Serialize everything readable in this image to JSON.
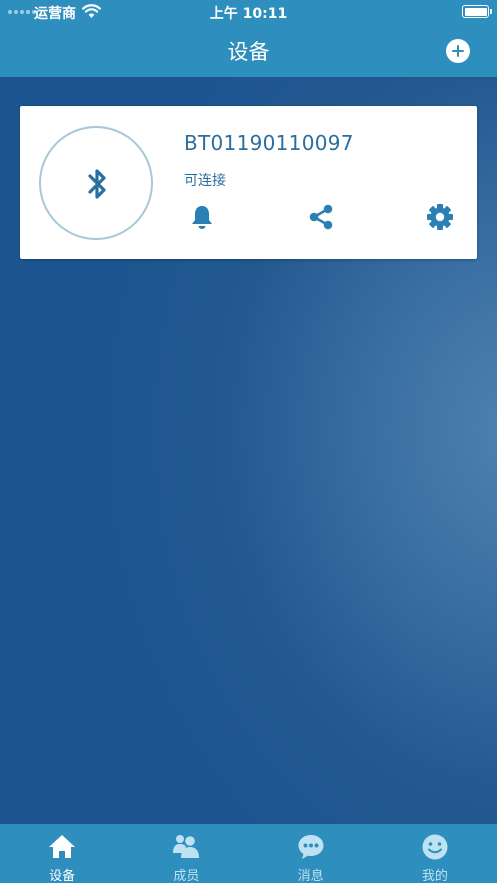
{
  "status_bar": {
    "carrier": "运营商",
    "time": "上午 10:11"
  },
  "header": {
    "title": "设备"
  },
  "device": {
    "name": "BT01190110097",
    "status": "可连接",
    "icon": "bluetooth-icon",
    "actions": [
      "bell-icon",
      "share-icon",
      "gear-icon"
    ]
  },
  "tabs": [
    {
      "label": "设备",
      "icon": "home-icon",
      "active": true
    },
    {
      "label": "成员",
      "icon": "members-icon",
      "active": false
    },
    {
      "label": "消息",
      "icon": "chat-bubble-icon",
      "active": false
    },
    {
      "label": "我的",
      "icon": "smiley-icon",
      "active": false
    }
  ],
  "colors": {
    "header": "#2e8fbf",
    "background": "#1d5a93",
    "accent": "#2a6f9e",
    "card": "#ffffff"
  }
}
